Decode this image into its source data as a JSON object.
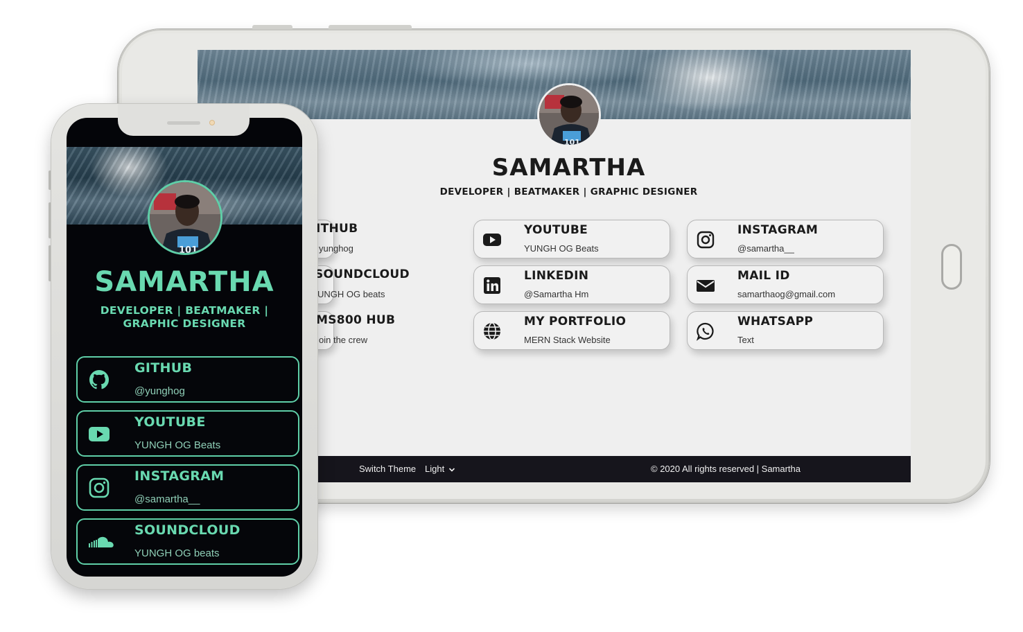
{
  "profile": {
    "name": "SAMARTHA",
    "tagline": "DEVELOPER | BEATMAKER | GRAPHIC DESIGNER",
    "tagline_line1": "DEVELOPER | BEATMAKER |",
    "tagline_line2": "GRAPHIC DESIGNER"
  },
  "tablet": {
    "links": [
      {
        "title": "ITHUB",
        "subtitle": "yunghog",
        "icon": "github-icon"
      },
      {
        "title": "YOUTUBE",
        "subtitle": "YUNGH OG Beats",
        "icon": "youtube-icon"
      },
      {
        "title": "INSTAGRAM",
        "subtitle": "@samartha__",
        "icon": "instagram-icon"
      },
      {
        "title": "SOUNDCLOUD",
        "subtitle": "UNGH OG beats",
        "icon": "soundcloud-icon"
      },
      {
        "title": "LINKEDIN",
        "subtitle": "@Samartha Hm",
        "icon": "linkedin-icon"
      },
      {
        "title": "MAIL ID",
        "subtitle": "samarthaog@gmail.com",
        "icon": "mail-icon"
      },
      {
        "title": "MS800 HUB",
        "subtitle": "oin the crew",
        "icon": "hub-icon"
      },
      {
        "title": "MY PORTFOLIO",
        "subtitle": "MERN Stack Website",
        "icon": "globe-icon"
      },
      {
        "title": "WHATSAPP",
        "subtitle": "Text",
        "icon": "whatsapp-icon"
      }
    ],
    "footer": {
      "switch_label": "Switch Theme",
      "theme_value": "Light",
      "copyright": "© 2020 All rights reserved | Samartha"
    }
  },
  "phone": {
    "links": [
      {
        "title": "GITHUB",
        "subtitle": "@yunghog",
        "icon": "github-icon"
      },
      {
        "title": "YOUTUBE",
        "subtitle": "YUNGH OG Beats",
        "icon": "youtube-icon"
      },
      {
        "title": "INSTAGRAM",
        "subtitle": "@samartha__",
        "icon": "instagram-icon"
      },
      {
        "title": "SOUNDCLOUD",
        "subtitle": "YUNGH OG beats",
        "icon": "soundcloud-icon"
      }
    ]
  },
  "colors": {
    "accent_green": "#69d9b0",
    "phone_bg": "#040509",
    "tablet_bg": "#efefef",
    "footer_bg": "#16151c"
  }
}
